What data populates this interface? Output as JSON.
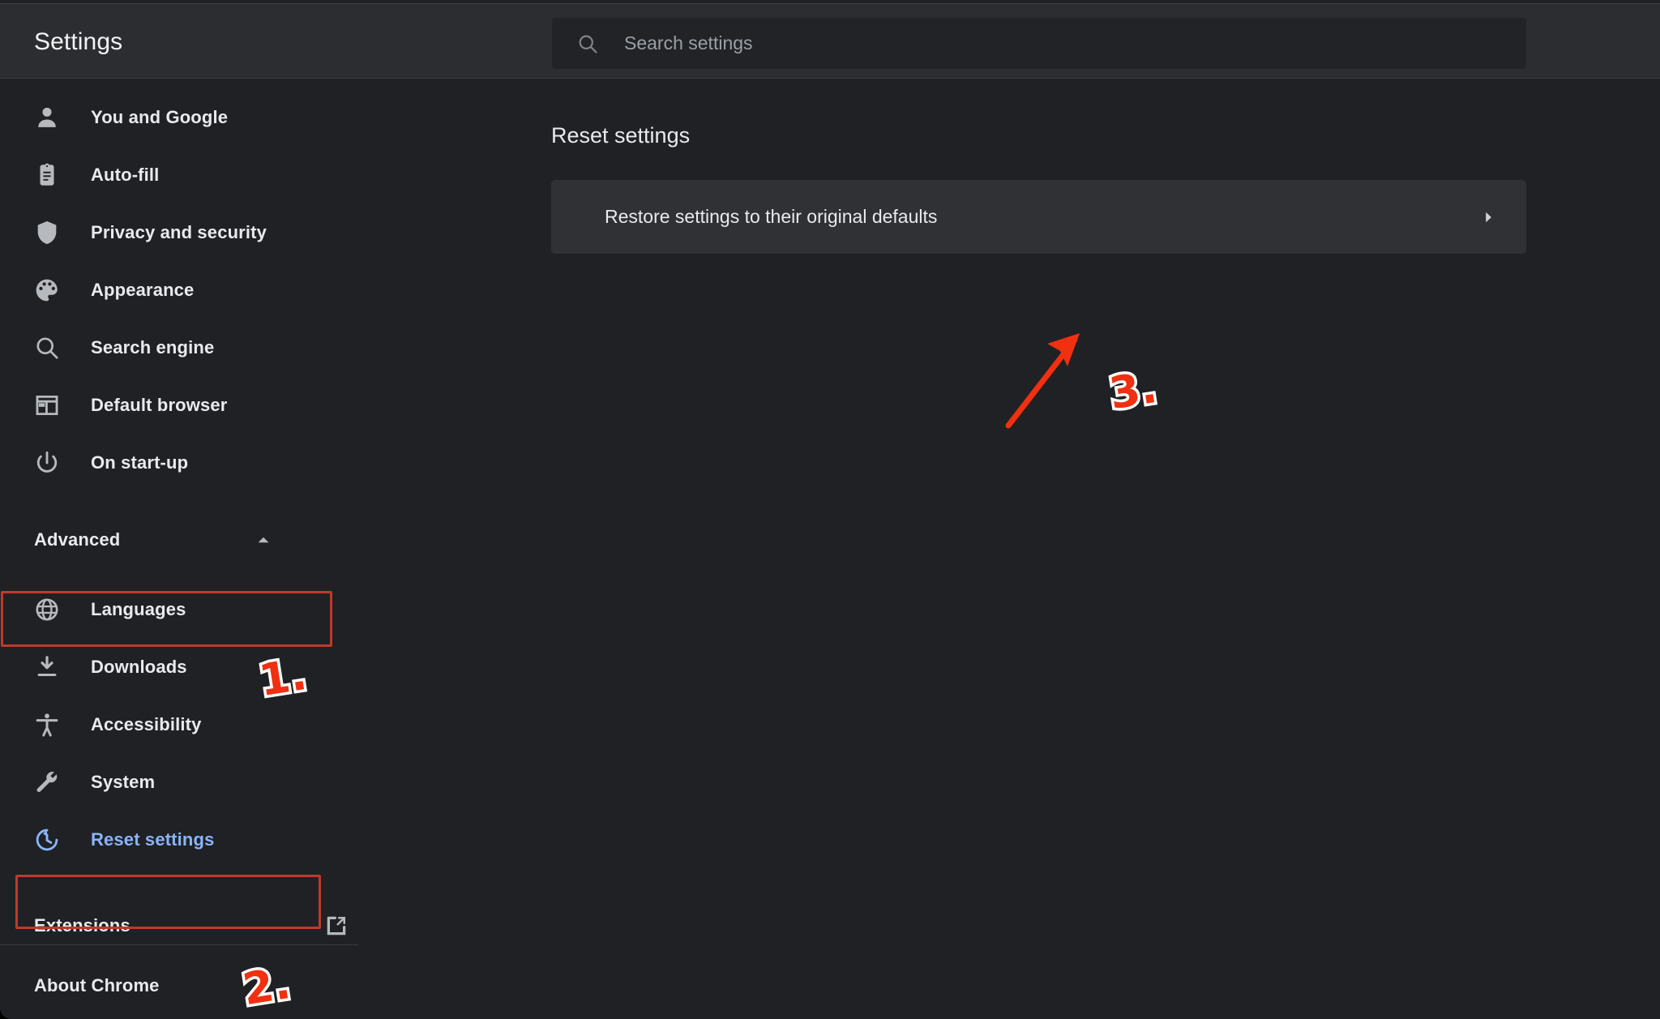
{
  "window": {
    "app_title": "Settings",
    "background_color": "#202124",
    "header_color": "#2c2d30",
    "accent_color": "#8ab4f8",
    "annotation_color": "#f03010",
    "annotation_box_color": "#c0392b"
  },
  "search": {
    "placeholder": "Search settings",
    "value": "",
    "icon": "search-icon"
  },
  "sidebar": {
    "items": [
      {
        "label": "You and Google",
        "icon": "person-icon",
        "selected": false
      },
      {
        "label": "Auto-fill",
        "icon": "clipboard-icon",
        "selected": false
      },
      {
        "label": "Privacy and security",
        "icon": "shield-icon",
        "selected": false
      },
      {
        "label": "Appearance",
        "icon": "palette-icon",
        "selected": false
      },
      {
        "label": "Search engine",
        "icon": "search-icon",
        "selected": false
      },
      {
        "label": "Default browser",
        "icon": "browser-window-icon",
        "selected": false
      },
      {
        "label": "On start-up",
        "icon": "power-icon",
        "selected": false
      }
    ],
    "advanced": {
      "label": "Advanced",
      "expanded": true,
      "chevron_icon": "chevron-up-icon"
    },
    "advanced_items": [
      {
        "label": "Languages",
        "icon": "globe-icon",
        "selected": false
      },
      {
        "label": "Downloads",
        "icon": "download-icon",
        "selected": false
      },
      {
        "label": "Accessibility",
        "icon": "accessibility-icon",
        "selected": false
      },
      {
        "label": "System",
        "icon": "wrench-icon",
        "selected": false
      },
      {
        "label": "Reset settings",
        "icon": "history-icon",
        "selected": true
      }
    ],
    "footer": [
      {
        "label": "Extensions",
        "external_icon": "external-link-icon"
      },
      {
        "label": "About Chrome",
        "external_icon": ""
      }
    ]
  },
  "main": {
    "heading": "Reset settings",
    "card": {
      "label": "Restore settings to their original defaults",
      "arrow_icon": "chevron-right-icon"
    }
  },
  "annotations": {
    "step_1": "1.",
    "step_2": "2.",
    "step_3": "3.",
    "arrow": "red-arrow-icon"
  }
}
